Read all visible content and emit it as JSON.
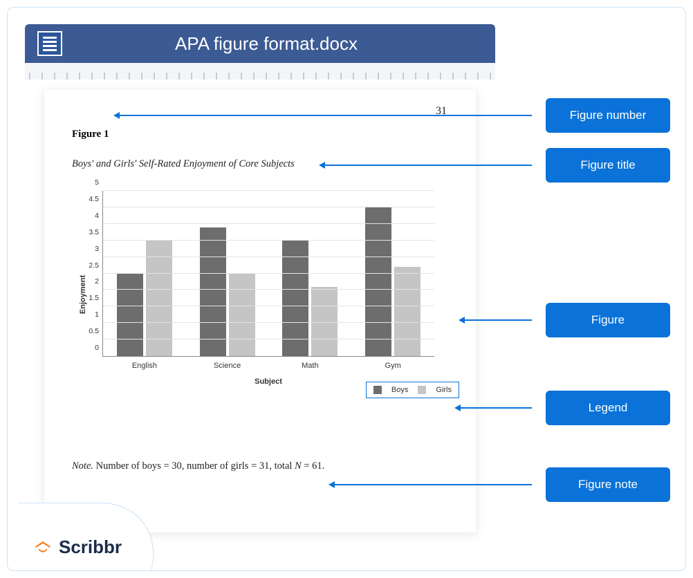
{
  "titlebar": {
    "filename": "APA figure format.docx"
  },
  "page_number": "31",
  "figure_number": "Figure 1",
  "figure_title": "Boys' and Girls' Self-Rated Enjoyment of Core Subjects",
  "figure_note": {
    "label": "Note.",
    "text_before_N": " Number of boys = 30, number of girls = 31, total ",
    "N": "N",
    "text_after_N": " = 61."
  },
  "callouts": {
    "figure_number": "Figure number",
    "figure_title": "Figure title",
    "figure": "Figure",
    "legend": "Legend",
    "figure_note": "Figure note"
  },
  "logo_text": "Scribbr",
  "chart_data": {
    "type": "bar",
    "title": "",
    "xlabel": "Subject",
    "ylabel": "Enjoyment",
    "ylim": [
      0,
      5
    ],
    "y_ticks": [
      0,
      0.5,
      1,
      1.5,
      2,
      2.5,
      3,
      3.5,
      4,
      4.5,
      5
    ],
    "categories": [
      "English",
      "Science",
      "Math",
      "Gym"
    ],
    "series": [
      {
        "name": "Boys",
        "values": [
          2.5,
          3.9,
          3.5,
          4.5
        ]
      },
      {
        "name": "Girls",
        "values": [
          3.5,
          2.5,
          2.1,
          2.7
        ]
      }
    ]
  }
}
